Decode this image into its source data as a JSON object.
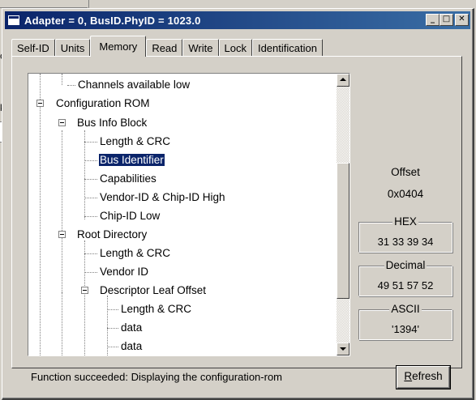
{
  "background_window": {
    "fragments": [
      "c",
      "k"
    ]
  },
  "window": {
    "title": "Adapter = 0, BusID.PhyID = 1023.0",
    "minimize_glyph": "_",
    "maximize_glyph": "□",
    "close_glyph": "✕"
  },
  "tabs": [
    {
      "label": "Self-ID"
    },
    {
      "label": "Units"
    },
    {
      "label": "Memory"
    },
    {
      "label": "Read"
    },
    {
      "label": "Write"
    },
    {
      "label": "Lock"
    },
    {
      "label": "Identification"
    }
  ],
  "active_tab": "Memory",
  "tree": {
    "items": [
      {
        "label": "Channels available low",
        "level": 2
      },
      {
        "label": "Configuration ROM",
        "level": 0
      },
      {
        "label": "Bus Info Block",
        "level": 1
      },
      {
        "label": "Length & CRC",
        "level": 2
      },
      {
        "label": "Bus Identifier",
        "level": 2,
        "selected": true
      },
      {
        "label": "Capabilities",
        "level": 2
      },
      {
        "label": "Vendor-ID & Chip-ID High",
        "level": 2
      },
      {
        "label": "Chip-ID Low",
        "level": 2
      },
      {
        "label": "Root Directory",
        "level": 1
      },
      {
        "label": "Length & CRC",
        "level": 2
      },
      {
        "label": "Vendor ID",
        "level": 2
      },
      {
        "label": "Descriptor Leaf Offset",
        "level": 2
      },
      {
        "label": "Length & CRC",
        "level": 3
      },
      {
        "label": "data",
        "level": 3
      },
      {
        "label": "data",
        "level": 3
      }
    ]
  },
  "info": {
    "offset_label": "Offset",
    "offset_value": "0x0404",
    "hex_label": "HEX",
    "hex_value": "31 33 39 34",
    "decimal_label": "Decimal",
    "decimal_value": "49 51 57 52",
    "ascii_label": "ASCII",
    "ascii_value": "'1394'"
  },
  "status_text": "Function succeeded: Displaying the configuration-rom",
  "refresh_button": {
    "accel": "R",
    "rest": "efresh"
  }
}
